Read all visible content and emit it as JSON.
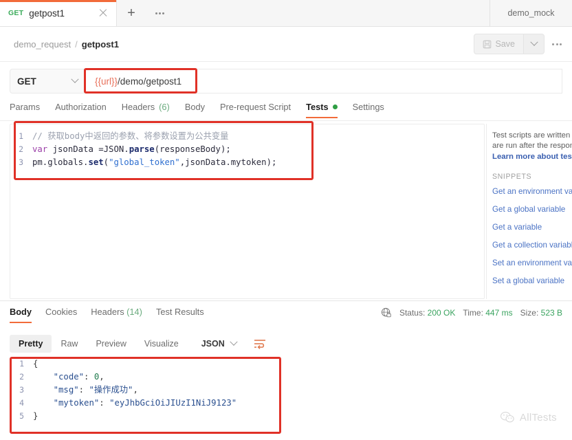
{
  "tabstrip": {
    "request_tab": {
      "method": "GET",
      "name": "getpost1",
      "close_icon": "close-icon"
    },
    "new_tab_icon": "plus-icon",
    "more_icon": "ellipsis-icon",
    "environment": "demo_mock"
  },
  "breadcrumb": {
    "collection": "demo_request",
    "separator": "/",
    "request": "getpost1",
    "save_label": "Save",
    "save_icon": "floppy-disk-icon",
    "save_caret_icon": "chevron-down-icon",
    "more_icon": "ellipsis-icon"
  },
  "url_bar": {
    "method": "GET",
    "method_caret_icon": "chevron-down-icon",
    "url_variable": "{{url}}",
    "url_path": "/demo/getpost1",
    "url_full": "{{url}}/demo/getpost1"
  },
  "request_tabs": [
    {
      "label": "Params",
      "active": false
    },
    {
      "label": "Authorization",
      "active": false
    },
    {
      "label": "Headers",
      "count": "(6)",
      "active": false
    },
    {
      "label": "Body",
      "active": false
    },
    {
      "label": "Pre-request Script",
      "active": false
    },
    {
      "label": "Tests",
      "active": true,
      "dot": true
    },
    {
      "label": "Settings",
      "active": false
    }
  ],
  "tests_editor": {
    "lines": [
      {
        "n": "1",
        "text": "// 获取body中返回的参数、将参数设置为公共变量"
      },
      {
        "n": "2",
        "text": "var jsonData =JSON.parse(responseBody);"
      },
      {
        "n": "3",
        "text": "pm.globals.set(\"global_token\",jsonData.mytoken);"
      }
    ],
    "l1_comment": "// 获取body中返回的参数、将参数设置为公共变量",
    "l2_kw": "var",
    "l2_a": " jsonData =JSON.",
    "l2_fn": "parse",
    "l2_b": "(responseBody);",
    "l3_a": "pm.globals.",
    "l3_fn": "set",
    "l3_b": "(",
    "l3_str": "\"global_token\"",
    "l3_c": ",jsonData.mytoken);"
  },
  "snippets": {
    "desc_line1": "Test scripts are written in",
    "desc_line2": "are run after the response",
    "learn_more": "Learn more about tests s",
    "heading": "SNIPPETS",
    "items": [
      "Get an environment variab",
      "Get a global variable",
      "Get a variable",
      "Get a collection variable",
      "Set an environment variab",
      "Set a global variable"
    ]
  },
  "response": {
    "tabs": [
      {
        "label": "Body",
        "active": true
      },
      {
        "label": "Cookies",
        "active": false
      },
      {
        "label": "Headers",
        "count": "(14)",
        "active": false
      },
      {
        "label": "Test Results",
        "active": false
      }
    ],
    "meta_icon": "globe-lock-icon",
    "status_label": "Status:",
    "status_value": "200 OK",
    "time_label": "Time:",
    "time_value": "447 ms",
    "size_label": "Size:",
    "size_value": "523 B",
    "view_tabs": [
      {
        "label": "Pretty",
        "active": true
      },
      {
        "label": "Raw",
        "active": false
      },
      {
        "label": "Preview",
        "active": false
      },
      {
        "label": "Visualize",
        "active": false
      }
    ],
    "format": "JSON",
    "format_caret_icon": "chevron-down-icon",
    "wrap_icon": "word-wrap-icon",
    "body_lines": [
      {
        "n": "1",
        "text": "{"
      },
      {
        "n": "2",
        "text": "    \"code\": 0,"
      },
      {
        "n": "3",
        "text": "    \"msg\": \"操作成功\","
      },
      {
        "n": "4",
        "text": "    \"mytoken\": \"eyJhbGciOiJIUzI1NiJ9123\""
      },
      {
        "n": "5",
        "text": "}"
      }
    ],
    "b1": "{",
    "b2_key": "\"code\"",
    "b2_sep": ": ",
    "b2_val": "0",
    "b2_end": ",",
    "b3_key": "\"msg\"",
    "b3_sep": ": ",
    "b3_val": "\"操作成功\"",
    "b3_end": ",",
    "b4_key": "\"mytoken\"",
    "b4_sep": ": ",
    "b4_val": "\"eyJhbGciOiJIUzI1NiJ9123\"",
    "b5": "}"
  },
  "watermark": {
    "text": "AllTests",
    "icon": "wechat-icon"
  },
  "colors": {
    "accent_orange": "#f26b3a",
    "annotation_red": "#e03127",
    "status_green": "#3aa35f",
    "link_blue": "#4a72c4"
  }
}
